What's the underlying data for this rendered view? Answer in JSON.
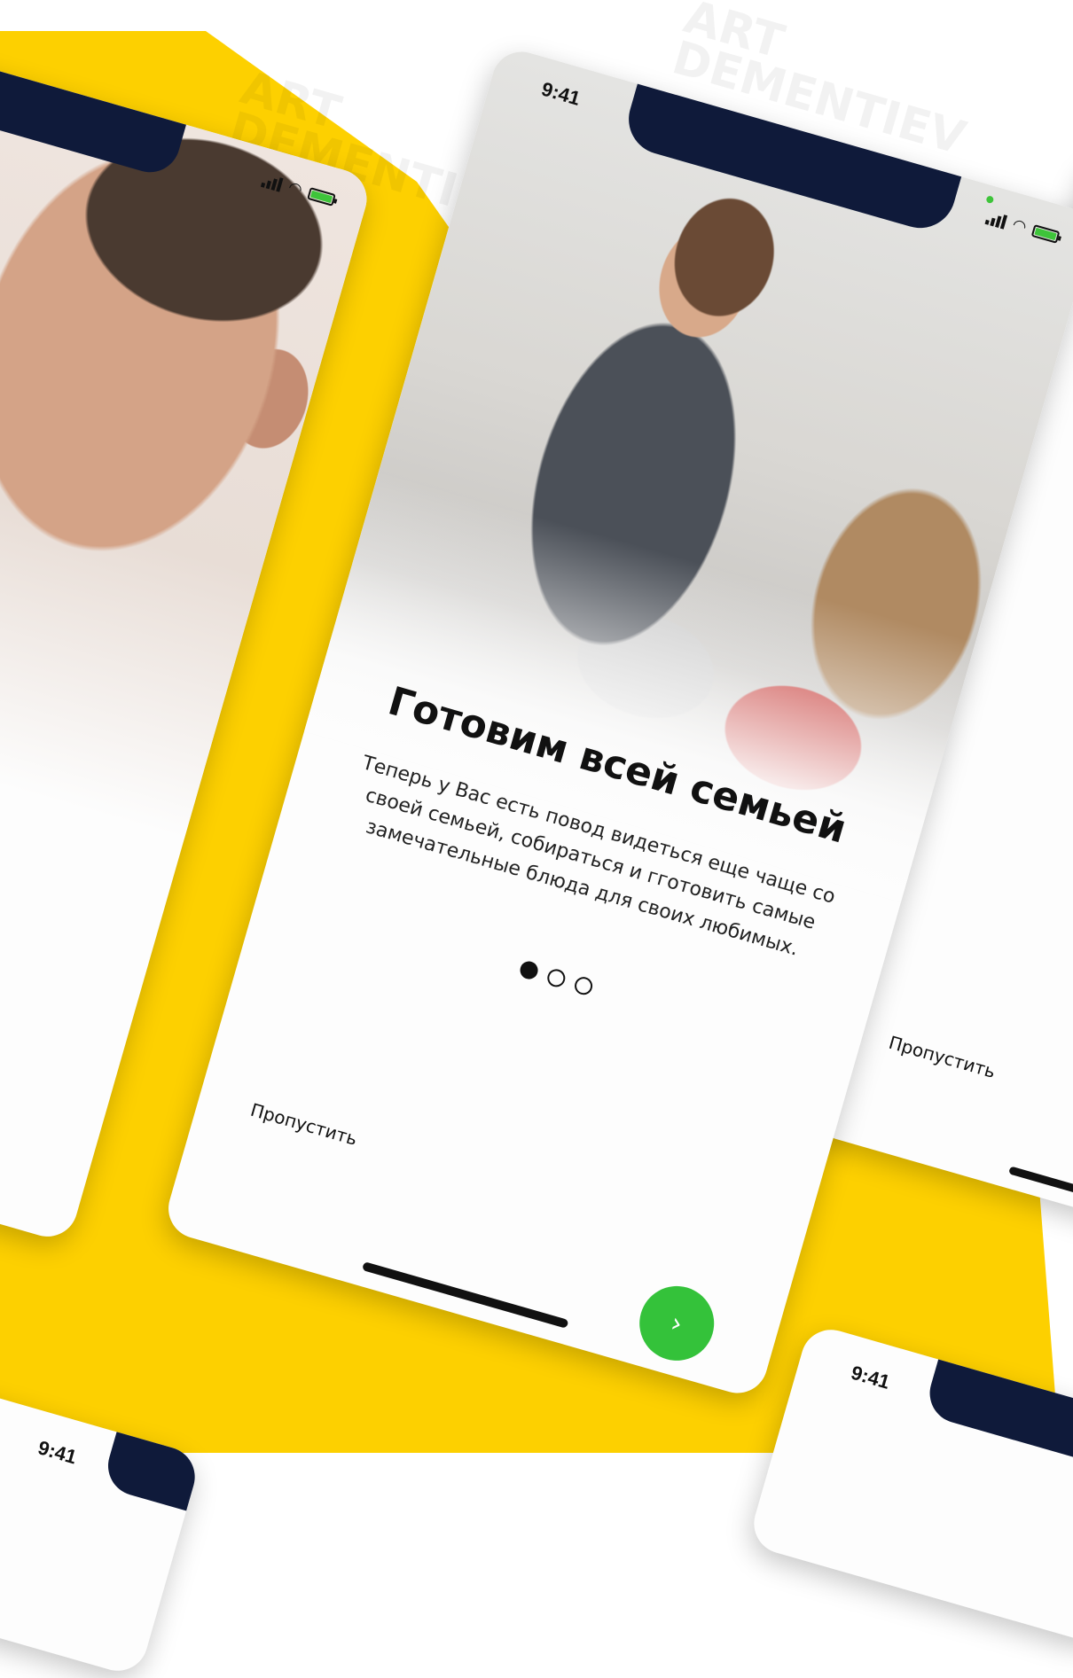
{
  "colors": {
    "accent_yellow": "#fdd000",
    "notch_navy": "#0f1a3a",
    "next_green": "#34c23a",
    "battery_green": "#3ec43a"
  },
  "watermark": {
    "line1": "ART",
    "line2": "DEMENTIEV"
  },
  "main_phone": {
    "status_time": "9:41",
    "status_icons": [
      "signal-icon",
      "wifi-icon",
      "battery-icon"
    ],
    "title": "Готовим всей семьей",
    "body": "Теперь у Вас есть повод видеться еще чаще со своей семьей, собираться и гготовить самые замечательные блюда для своих любимых.",
    "pager": {
      "total": 3,
      "active_index": 0
    },
    "skip_label": "Пропустить",
    "next_icon": "chevron-right-icon"
  },
  "right_phone": {
    "skip_label": "Пропустить"
  },
  "bottom_right_phone": {
    "status_time": "9:41"
  },
  "bottom_left_phone": {
    "status_time": "9:41"
  }
}
